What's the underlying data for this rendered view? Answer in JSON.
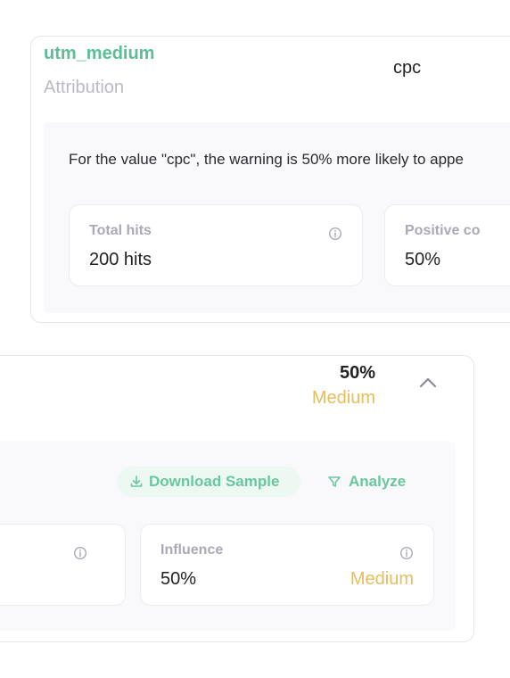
{
  "top_card": {
    "field_name": "utm_medium",
    "field_category": "Attribution",
    "field_value": "cpc",
    "description": "For the value \"cpc\", the warning is 50% more likely to appe",
    "stats": [
      {
        "label": "Total hits",
        "value": "200 hits"
      },
      {
        "label": "Positive co",
        "value": "50%"
      }
    ]
  },
  "bottom_card": {
    "percentage": "50%",
    "level": "Medium",
    "buttons": {
      "download_label": "Download Sample",
      "analyze_label": "Analyze"
    },
    "influence": {
      "label": "Influence",
      "value": "50%",
      "level": "Medium"
    }
  },
  "colors": {
    "accent_green": "#5bbf95",
    "medium_yellow": "#e7bd5b",
    "muted_text": "#b9bac4"
  },
  "icons": [
    "info-icon",
    "chevron-up-icon",
    "download-icon",
    "filter-icon"
  ]
}
